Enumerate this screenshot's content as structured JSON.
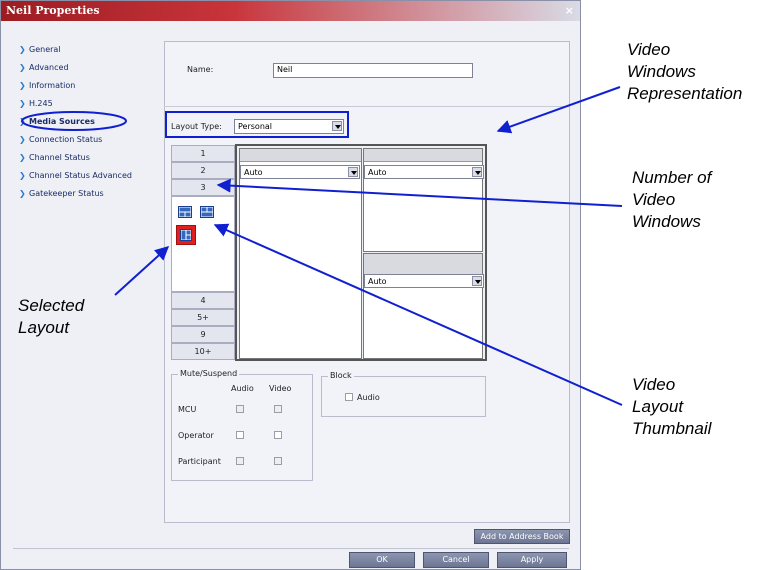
{
  "window": {
    "title": "Neil Properties",
    "close": "×"
  },
  "nav": {
    "items": [
      {
        "label": "General"
      },
      {
        "label": "Advanced"
      },
      {
        "label": "Information"
      },
      {
        "label": "H.245"
      },
      {
        "label": "Media Sources"
      },
      {
        "label": "Connection Status"
      },
      {
        "label": "Channel Status"
      },
      {
        "label": "Channel Status Advanced"
      },
      {
        "label": "Gatekeeper Status"
      }
    ],
    "selected": "Media Sources"
  },
  "form": {
    "name_label": "Name:",
    "name_value": "Neil",
    "layout_type_label": "Layout Type:",
    "layout_type_value": "Personal"
  },
  "layout": {
    "tabs_top": [
      "1",
      "2",
      "3"
    ],
    "tabs_bottom": [
      "4",
      "5+",
      "9",
      "10+"
    ],
    "pane_sources": [
      "Auto",
      "Auto",
      "Auto"
    ]
  },
  "mute": {
    "group_title": "Mute/Suspend",
    "col_audio": "Audio",
    "col_video": "Video",
    "rows": [
      "MCU",
      "Operator",
      "Participant"
    ]
  },
  "block": {
    "group_title": "Block",
    "audio_label": "Audio"
  },
  "buttons": {
    "add_to_address_book": "Add to Address Book",
    "ok": "OK",
    "cancel": "Cancel",
    "apply": "Apply"
  },
  "annotations": {
    "video_windows_rep": [
      "Video",
      "Windows",
      "Representation"
    ],
    "number_of_windows": [
      "Number of",
      "Video",
      "Windows"
    ],
    "selected_layout": [
      "Selected",
      "Layout"
    ],
    "video_layout_thumb": [
      "Video",
      "Layout",
      "Thumbnail"
    ]
  },
  "colors": {
    "annotation_blue": "#1020d0",
    "title_red": "#b2272d",
    "selected_thumb": "#e02020"
  }
}
